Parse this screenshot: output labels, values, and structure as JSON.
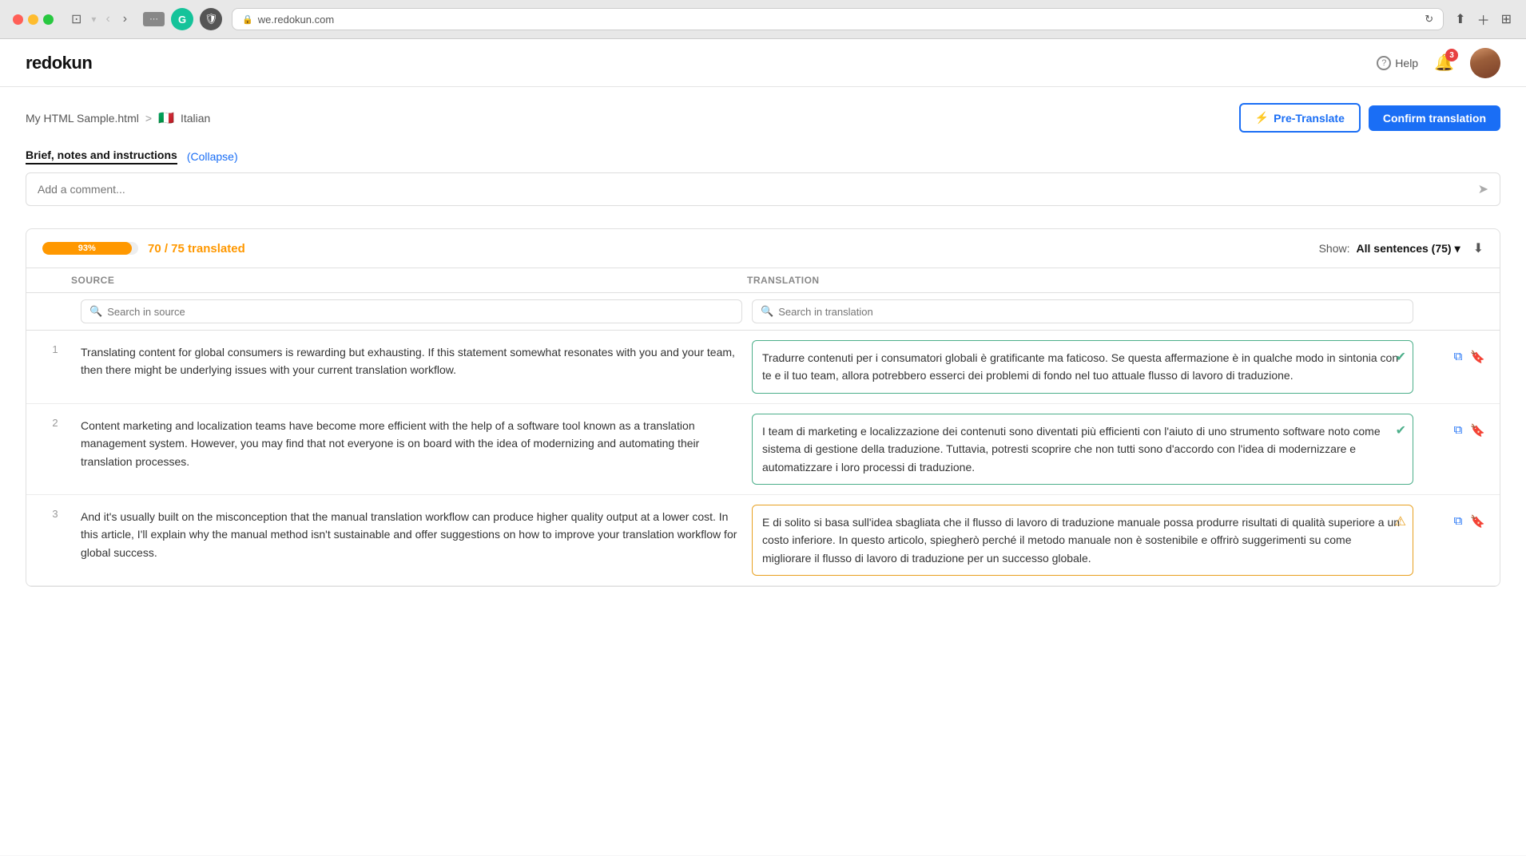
{
  "browser": {
    "url": "we.redokun.com",
    "reload_icon": "↻"
  },
  "header": {
    "logo": "redokun",
    "help_label": "Help",
    "notification_count": "3"
  },
  "breadcrumb": {
    "file": "My HTML Sample.html",
    "separator": ">",
    "flag": "🇮🇹",
    "language": "Italian"
  },
  "buttons": {
    "pre_translate": "Pre-Translate",
    "confirm": "Confirm translation"
  },
  "brief": {
    "title": "Brief, notes and instructions",
    "collapse": "(Collapse)",
    "comment_placeholder": "Add a comment..."
  },
  "table": {
    "progress_pct": "93%",
    "translated_label": "70 / 75 translated",
    "show_label": "Show:",
    "show_value": "All sentences (75)",
    "col_source": "SOURCE",
    "col_translation": "TRANSLATION",
    "search_source_placeholder": "Search in source",
    "search_translation_placeholder": "Search in translation",
    "rows": [
      {
        "number": "1",
        "source": "Translating content for global consumers is rewarding but exhausting. If this statement somewhat resonates with you and your team, then there might be underlying issues with your current translation workflow.",
        "translation": "Tradurre contenuti per i consumatori globali è gratificante ma faticoso. Se questa affermazione è in qualche modo in sintonia con te e il tuo team, allora potrebbero esserci dei problemi di fondo nel tuo attuale flusso di lavoro di traduzione.",
        "status": "green"
      },
      {
        "number": "2",
        "source": "Content marketing and localization teams have become more efficient with the help of a software tool known as a translation management system. However, you may find that not everyone is on board with the idea of modernizing and automating their translation processes.",
        "translation": "I team di marketing e localizzazione dei contenuti sono diventati più efficienti con l'aiuto di uno strumento software noto come sistema di gestione della traduzione. Tuttavia, potresti scoprire che non tutti sono d'accordo con l'idea di modernizzare e automatizzare i loro processi di traduzione.",
        "status": "green"
      },
      {
        "number": "3",
        "source": "And it's usually built on the misconception that the manual translation workflow can produce higher quality output at a lower cost. In this article, I'll explain why the manual method isn't sustainable and offer suggestions on how to improve your translation workflow for global success.",
        "translation": "E di solito si basa sull'idea sbagliata che il flusso di lavoro di traduzione manuale possa produrre risultati di qualità superiore a un costo inferiore. In questo articolo, spiegherò perché il metodo manuale non è sostenibile e offrirò suggerimenti su come migliorare il flusso di lavoro di traduzione per un successo globale.",
        "status": "warning"
      }
    ]
  }
}
